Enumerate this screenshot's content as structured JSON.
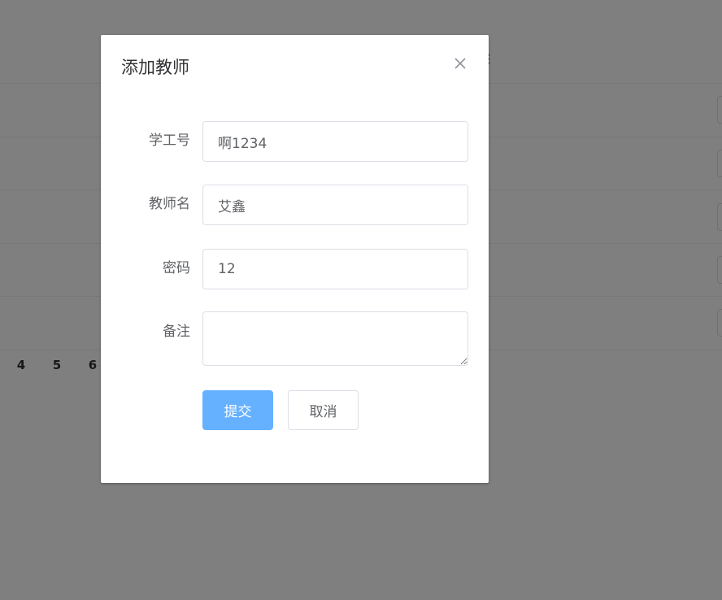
{
  "background": {
    "pagination": [
      "4",
      "5",
      "6"
    ]
  },
  "dialog": {
    "title": "添加教师",
    "close_icon": "close-icon",
    "fields": [
      {
        "label": "学工号",
        "value": "啊1234",
        "placeholder": ""
      },
      {
        "label": "教师名",
        "value": "艾鑫",
        "placeholder": ""
      },
      {
        "label": "密码",
        "value": "12",
        "placeholder": ""
      },
      {
        "label": "备注",
        "value": "",
        "placeholder": ""
      }
    ],
    "submit_label": "提交",
    "cancel_label": "取消"
  },
  "colors": {
    "overlay": "#808080",
    "primary": "#66b1ff",
    "border": "#dcdfe6",
    "text": "#606266",
    "title": "#303133"
  }
}
